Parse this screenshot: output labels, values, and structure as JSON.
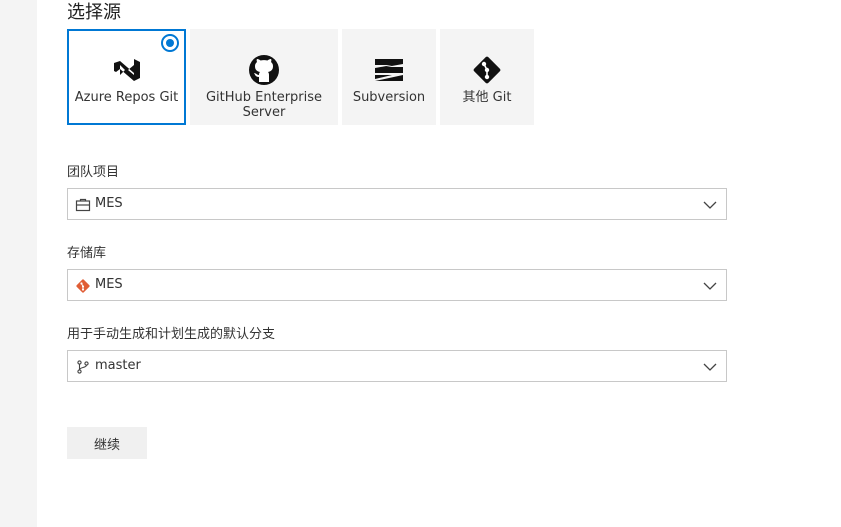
{
  "page": {
    "title": "选择源"
  },
  "sources": [
    {
      "label": "Azure Repos Git",
      "icon": "azure-repos-icon",
      "selected": true
    },
    {
      "label": "GitHub Enterprise Server",
      "icon": "github-icon",
      "selected": false
    },
    {
      "label": "Subversion",
      "icon": "subversion-icon",
      "selected": false
    },
    {
      "label": "其他 Git",
      "icon": "git-icon",
      "selected": false
    }
  ],
  "fields": {
    "team_project": {
      "label": "团队项目",
      "value": "MES",
      "icon": "project-icon"
    },
    "repository": {
      "label": "存储库",
      "value": "MES",
      "icon": "git-repo-icon"
    },
    "default_branch": {
      "label": "用于手动生成和计划生成的默认分支",
      "value": "master",
      "icon": "branch-icon"
    }
  },
  "actions": {
    "continue_label": "继续"
  },
  "colors": {
    "accent": "#0078d4",
    "git_orange": "#e05d35",
    "tile_bg": "#f4f4f4"
  }
}
